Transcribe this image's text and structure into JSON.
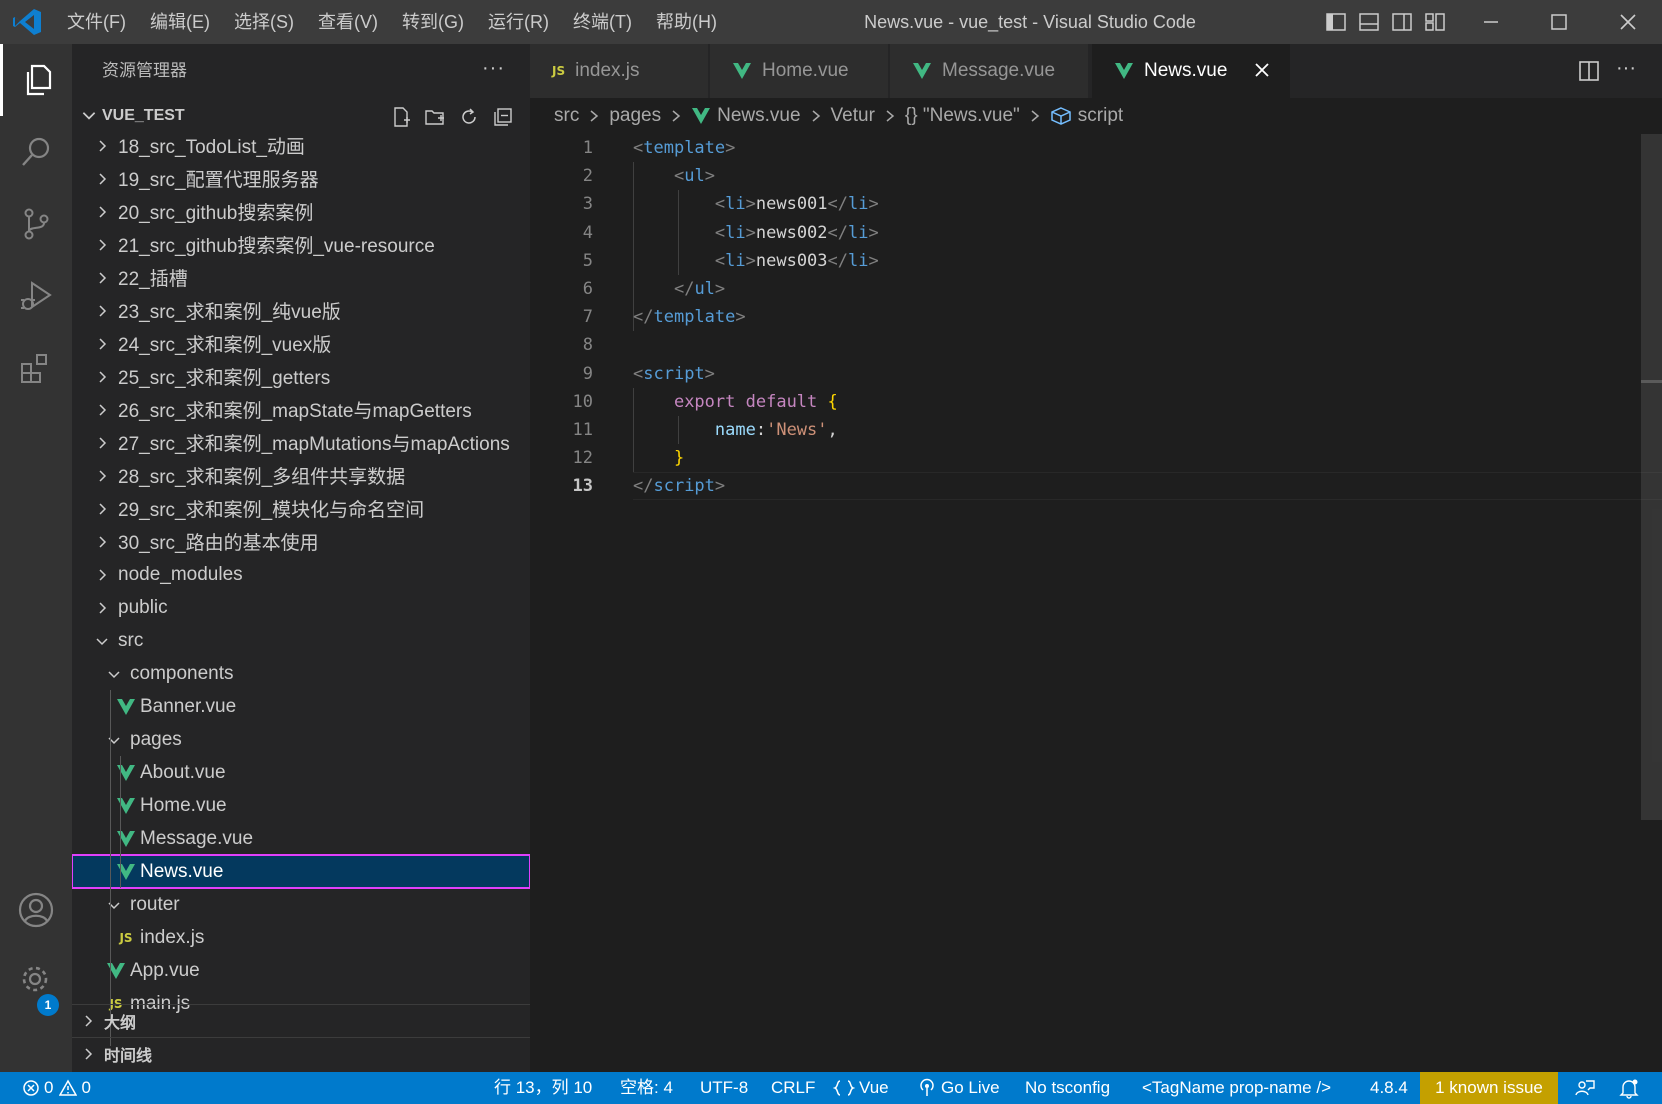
{
  "titlebar": {
    "menu": [
      "文件(F)",
      "编辑(E)",
      "选择(S)",
      "查看(V)",
      "转到(G)",
      "运行(R)",
      "终端(T)",
      "帮助(H)"
    ],
    "window_title": "News.vue - vue_test - Visual Studio Code"
  },
  "activity": {
    "settings_badge": "1"
  },
  "sidebar": {
    "title": "资源管理器",
    "more": "···",
    "section_title": "VUE_TEST",
    "tree": [
      {
        "label": "18_src_TodoList_动画"
      },
      {
        "label": "19_src_配置代理服务器"
      },
      {
        "label": "20_src_github搜索案例"
      },
      {
        "label": "21_src_github搜索案例_vue-resource"
      },
      {
        "label": "22_插槽"
      },
      {
        "label": "23_src_求和案例_纯vue版"
      },
      {
        "label": "24_src_求和案例_vuex版"
      },
      {
        "label": "25_src_求和案例_getters"
      },
      {
        "label": "26_src_求和案例_mapState与mapGetters"
      },
      {
        "label": "27_src_求和案例_mapMutations与mapActions"
      },
      {
        "label": "28_src_求和案例_多组件共享数据"
      },
      {
        "label": "29_src_求和案例_模块化与命名空间"
      },
      {
        "label": "30_src_路由的基本使用"
      },
      {
        "label": "node_modules"
      },
      {
        "label": "public"
      },
      {
        "label": "src"
      },
      {
        "label": "components"
      },
      {
        "label": "Banner.vue"
      },
      {
        "label": "pages"
      },
      {
        "label": "About.vue"
      },
      {
        "label": "Home.vue"
      },
      {
        "label": "Message.vue"
      },
      {
        "label": "News.vue"
      },
      {
        "label": "router"
      },
      {
        "label": "index.js"
      },
      {
        "label": "App.vue"
      },
      {
        "label": "main.js"
      }
    ],
    "js_icon": "JS",
    "outline_title": "大纲",
    "timeline_title": "时间线"
  },
  "tabs": [
    {
      "label": "index.js",
      "icon": "JS"
    },
    {
      "label": "Home.vue"
    },
    {
      "label": "Message.vue"
    },
    {
      "label": "News.vue"
    }
  ],
  "breadcrumb": {
    "items": [
      "src",
      "pages",
      "News.vue",
      "Vetur",
      "{} \"News.vue\"",
      "script"
    ]
  },
  "code": {
    "line_numbers": [
      "1",
      "2",
      "3",
      "4",
      "5",
      "6",
      "7",
      "8",
      "9",
      "10",
      "11",
      "12",
      "13"
    ],
    "lines": [
      [
        [
          "<",
          "p"
        ],
        [
          "template",
          "t"
        ],
        [
          ">",
          "p"
        ]
      ],
      [
        [
          "    ",
          ""
        ],
        [
          "<",
          "p"
        ],
        [
          "ul",
          "t"
        ],
        [
          ">",
          "p"
        ]
      ],
      [
        [
          "        ",
          ""
        ],
        [
          "<",
          "p"
        ],
        [
          "li",
          "t"
        ],
        [
          ">",
          "p"
        ],
        [
          "news001",
          "x"
        ],
        [
          "</",
          "p"
        ],
        [
          "li",
          "t"
        ],
        [
          ">",
          "p"
        ]
      ],
      [
        [
          "        ",
          ""
        ],
        [
          "<",
          "p"
        ],
        [
          "li",
          "t"
        ],
        [
          ">",
          "p"
        ],
        [
          "news002",
          "x"
        ],
        [
          "</",
          "p"
        ],
        [
          "li",
          "t"
        ],
        [
          ">",
          "p"
        ]
      ],
      [
        [
          "        ",
          ""
        ],
        [
          "<",
          "p"
        ],
        [
          "li",
          "t"
        ],
        [
          ">",
          "p"
        ],
        [
          "news003",
          "x"
        ],
        [
          "</",
          "p"
        ],
        [
          "li",
          "t"
        ],
        [
          ">",
          "p"
        ]
      ],
      [
        [
          "    ",
          ""
        ],
        [
          "</",
          "p"
        ],
        [
          "ul",
          "t"
        ],
        [
          ">",
          "p"
        ]
      ],
      [
        [
          "</",
          "p"
        ],
        [
          "template",
          "t"
        ],
        [
          ">",
          "p"
        ]
      ],
      [],
      [
        [
          "<",
          "p"
        ],
        [
          "script",
          "t"
        ],
        [
          ">",
          "p"
        ]
      ],
      [
        [
          "    ",
          ""
        ],
        [
          "export",
          "k"
        ],
        [
          " ",
          "x"
        ],
        [
          "default",
          "k"
        ],
        [
          " ",
          "x"
        ],
        [
          "{",
          "b"
        ]
      ],
      [
        [
          "        ",
          ""
        ],
        [
          "name",
          "v"
        ],
        [
          ":",
          "x"
        ],
        [
          "'News'",
          "s"
        ],
        [
          ",",
          "x"
        ]
      ],
      [
        [
          "    ",
          ""
        ],
        [
          "}",
          "b"
        ]
      ],
      [
        [
          "</",
          "p"
        ],
        [
          "script",
          "t"
        ],
        [
          ">",
          "p"
        ]
      ]
    ]
  },
  "statusbar": {
    "errors": "0",
    "warnings": "0",
    "position": "行 13，列 10",
    "spaces": "空格: 4",
    "encoding": "UTF-8",
    "eol": "CRLF",
    "language": "Vue",
    "golive": "Go Live",
    "tsconfig": "No tsconfig",
    "tagname": "<TagName prop-name />",
    "version": "4.8.4",
    "known_issue": "1 known issue"
  },
  "colors": {
    "accent": "#007acc",
    "vue_green": "#41b883",
    "selection_outline": "#e040fb",
    "known_issue_bg": "#c4a000"
  }
}
